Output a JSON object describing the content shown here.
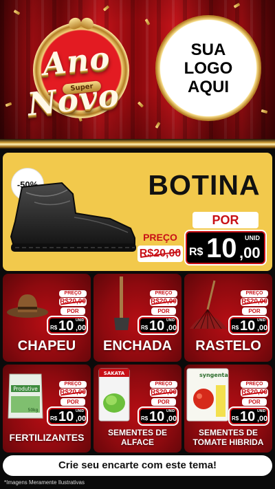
{
  "header": {
    "badge_word1": "Ano",
    "badge_word2": "Novo",
    "badge_super": "Super",
    "logo_line1": "SUA",
    "logo_line2": "LOGO",
    "logo_line3": "AQUI"
  },
  "hero": {
    "discount": "-50%",
    "title": "BOTINA",
    "preco_label": "PREÇO",
    "old_price": "R$20,00",
    "por_label": "POR",
    "price_currency": "R$",
    "price_int": "10",
    "price_dec": ",00",
    "unit": "UNID"
  },
  "products": [
    {
      "name_line1": "CHAPEU",
      "name_line2": "",
      "preco_label": "PREÇO",
      "old_price": "R$20,00",
      "por_label": "POR",
      "currency": "R$",
      "price_int": "10",
      "price_dec": ",00",
      "unit": "UNID"
    },
    {
      "name_line1": "ENCHADA",
      "name_line2": "",
      "preco_label": "PREÇO",
      "old_price": "R$20,00",
      "por_label": "POR",
      "currency": "R$",
      "price_int": "10",
      "price_dec": ",00",
      "unit": "UNID"
    },
    {
      "name_line1": "RASTELO",
      "name_line2": "",
      "preco_label": "PREÇO",
      "old_price": "R$20,00",
      "por_label": "POR",
      "currency": "R$",
      "price_int": "10",
      "price_dec": ",00",
      "unit": "UNID"
    },
    {
      "name_line1": "FERTILIZANTES",
      "name_line2": "",
      "preco_label": "PREÇO",
      "old_price": "R$20,00",
      "por_label": "POR",
      "currency": "R$",
      "price_int": "10",
      "price_dec": ",00",
      "unit": "UNID",
      "package_brand": "Produtive",
      "package_weight": "50kg"
    },
    {
      "name_line1": "SEMENTES DE",
      "name_line2": "ALFACE",
      "preco_label": "PREÇO",
      "old_price": "R$20,00",
      "por_label": "POR",
      "currency": "R$",
      "price_int": "10",
      "price_dec": ",00",
      "unit": "UNID",
      "package_brand": "SAKATA"
    },
    {
      "name_line1": "SEMENTES DE",
      "name_line2": "TOMATE HIBRIDA",
      "preco_label": "PREÇO",
      "old_price": "R$20,00",
      "por_label": "POR",
      "currency": "R$",
      "price_int": "10",
      "price_dec": ",00",
      "unit": "UNID",
      "package_brand": "syngenta"
    }
  ],
  "cta": "Crie seu encarte com este tema!",
  "disclaimer": "*Imagens Meramente Ilustrativas",
  "colors": {
    "red": "#c81016",
    "gold": "#f2c94c",
    "dark": "#0b0b0b"
  },
  "icons": [
    "hat-icon",
    "hoe-icon",
    "rake-icon",
    "fertilizer-bag-icon",
    "seed-packet-icon",
    "seed-packet-icon",
    "boot-icon"
  ]
}
